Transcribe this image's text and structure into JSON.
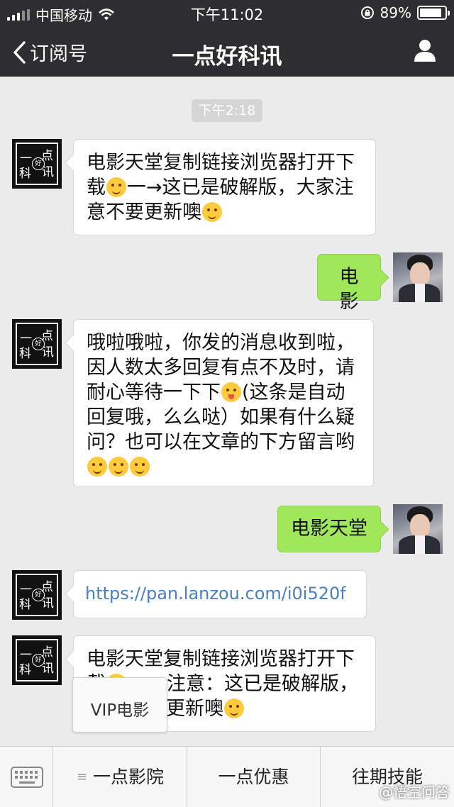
{
  "status_bar": {
    "carrier": "中国移动",
    "time": "下午11:02",
    "battery": "89%",
    "battery_level": 0.89
  },
  "nav": {
    "back_label": "订阅号",
    "title": "一点好科讯"
  },
  "chat": {
    "timestamp": "下午2:18",
    "avatar_chars": [
      "一",
      "点",
      "好",
      "科",
      "讯"
    ],
    "messages": [
      {
        "from": "account",
        "lines": [
          "电影天堂复制链接浏览器打开下",
          "载",
          "一→这已是破解版，大家注",
          "意不要更新噢"
        ]
      },
      {
        "from": "user",
        "text": "电影"
      },
      {
        "from": "account",
        "lines": [
          "哦啦哦啦，你发的消息收到啦，",
          "因人数太多回复有点不及时，请",
          "耐心等待一下下",
          "(这条是自动",
          "回复哦，么么哒）如果有什么疑",
          "问？也可以在文章的下方留言哟"
        ]
      },
      {
        "from": "user",
        "text": "电影天堂"
      },
      {
        "from": "account",
        "text": "https://pan.lanzou.com/i0i520f"
      },
      {
        "from": "account",
        "lines": [
          "电影天堂复制链接浏览器打开下",
          "载",
          "注意：这已是破解版，",
          "更新噢"
        ]
      }
    ]
  },
  "popup_menu": {
    "item": "VIP电影"
  },
  "bottom_menu": {
    "items": [
      "一点影院",
      "一点优惠",
      "往期技能"
    ],
    "watermark": "@悟空问答"
  },
  "icons": {
    "signal": "signal-icon",
    "wifi": "wifi-icon",
    "lock": "rotation-lock-icon",
    "battery": "battery-icon",
    "back": "chevron-left-icon",
    "profile": "person-icon",
    "keyboard": "keyboard-icon",
    "menu": "menu-lines-icon"
  },
  "colors": {
    "bar_bg": "#2e2e30",
    "chat_bg": "#ebebeb",
    "user_bubble": "#a0e75a",
    "link": "#4a7fc0"
  }
}
